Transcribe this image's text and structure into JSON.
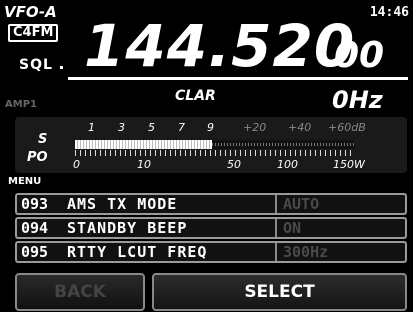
{
  "header": {
    "vfo": "VFO-A",
    "time": "14:46",
    "mode": "C4FM",
    "sql": "SQL"
  },
  "frequency": {
    "main": "144.520",
    "small": "00"
  },
  "amp": "AMP1",
  "clar": {
    "label": "CLAR",
    "value": "0Hz"
  },
  "meter": {
    "s_label": "S",
    "po_label": "PO",
    "s_scale": [
      "1",
      "3",
      "5",
      "7",
      "9",
      "+20",
      "+40",
      "+60dB"
    ],
    "po_scale": [
      "0",
      "10",
      "50",
      "100",
      "150W"
    ],
    "s_reading_fraction": 0.49
  },
  "menu": {
    "label": "MENU",
    "items": [
      {
        "num": "093",
        "name": "AMS TX MODE",
        "value": "AUTO"
      },
      {
        "num": "094",
        "name": "STANDBY BEEP",
        "value": "ON"
      },
      {
        "num": "095",
        "name": "RTTY LCUT FREQ",
        "value": "300Hz"
      }
    ]
  },
  "buttons": {
    "back": "BACK",
    "select": "SELECT"
  },
  "colors": {
    "background": "#000000",
    "text": "#ffffff",
    "dim": "#4a4a4a",
    "border": "#9a9a9a"
  }
}
